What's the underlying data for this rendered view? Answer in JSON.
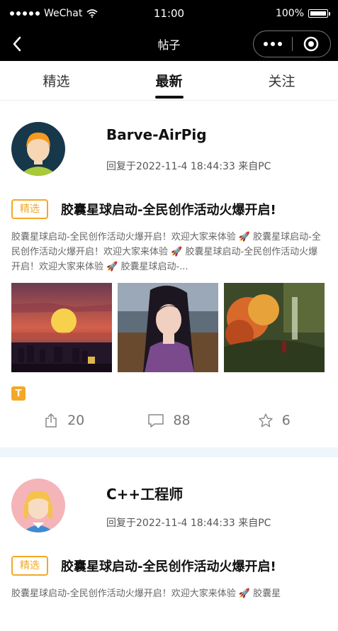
{
  "status_bar": {
    "carrier": "WeChat",
    "time": "11:00",
    "battery": "100%"
  },
  "nav": {
    "title": "帖子"
  },
  "tabs": [
    {
      "label": "精选",
      "active": false
    },
    {
      "label": "最新",
      "active": true
    },
    {
      "label": "关注",
      "active": false
    }
  ],
  "posts": [
    {
      "username": "Barve-AirPig",
      "meta": "回复于2022-11-4 18:44:33 来自PC",
      "badge": "精选",
      "title": "胶囊星球启动-全民创作活动火爆开启!",
      "excerpt": "胶囊星球启动-全民创作活动火爆开启！欢迎大家来体验 🚀 胶囊星球启动-全民创作活动火爆开启！欢迎大家来体验 🚀 胶囊星球启动-全民创作活动火爆开启！欢迎大家来体验 🚀 胶囊星球启动-...",
      "shares": "20",
      "comments": "88",
      "stars": "6"
    },
    {
      "username": "C++工程师",
      "meta": "回复于2022-11-4 18:44:33 来自PC",
      "badge": "精选",
      "title": "胶囊星球启动-全民创作活动火爆开启!",
      "excerpt": "胶囊星球启动-全民创作活动火爆开启！欢迎大家来体验 🚀 胶囊星"
    }
  ],
  "colors": {
    "accent": "#f3a826",
    "nav_bg": "#000000",
    "divider": "#eef5fb"
  },
  "icons": [
    "back-icon",
    "more-icon",
    "close-capsule-icon",
    "share-icon",
    "comment-icon",
    "star-icon",
    "t-icon"
  ]
}
